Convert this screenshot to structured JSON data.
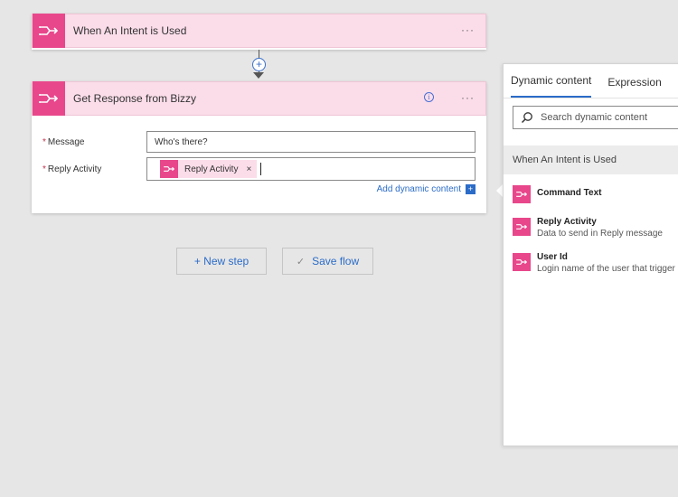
{
  "trigger_card": {
    "title": "When An Intent is Used",
    "more": "···",
    "icon": "bot-flow-icon"
  },
  "connector": {
    "plus": "+"
  },
  "action_card": {
    "title": "Get Response from Bizzy",
    "info": "i",
    "more": "···",
    "icon": "bot-flow-icon",
    "fields": {
      "message": {
        "required": "*",
        "label": "Message",
        "value": "Who's there?"
      },
      "reply_activity": {
        "required": "*",
        "label": "Reply Activity",
        "token_label": "Reply Activity",
        "token_remove": "×"
      }
    },
    "add_dynamic_content": "Add dynamic content",
    "add_dynamic_icon": "+"
  },
  "buttons": {
    "new_step": "+ New step",
    "save_flow": "Save flow",
    "save_icon": "✓"
  },
  "panel": {
    "tabs": [
      "Dynamic content",
      "Expression"
    ],
    "search_placeholder": "Search dynamic content",
    "section_title": "When An Intent is Used",
    "items": [
      {
        "title": "Command Text",
        "desc": ""
      },
      {
        "title": "Reply Activity",
        "desc": "Data to send in Reply message"
      },
      {
        "title": "User Id",
        "desc": "Login name of the user that trigger"
      }
    ]
  },
  "colors": {
    "brand": "#e8478b",
    "header_bg": "#fbdde9",
    "link": "#2b6cc8"
  }
}
